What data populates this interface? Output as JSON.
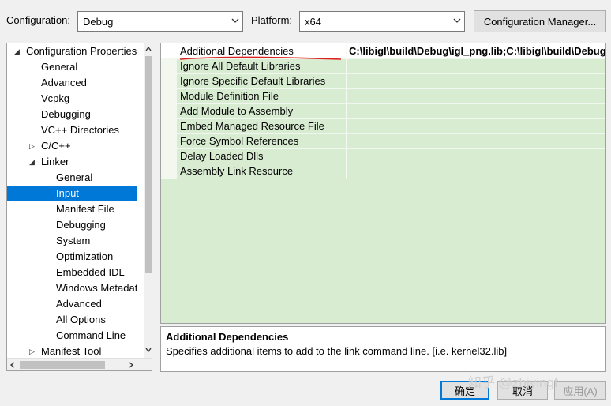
{
  "toolbar": {
    "configuration_label": "Configuration:",
    "configuration_value": "Debug",
    "platform_label": "Platform:",
    "platform_value": "x64",
    "config_manager_button": "Configuration Manager..."
  },
  "tree": {
    "items": [
      {
        "label": "Configuration Properties",
        "glyph": "◢"
      },
      {
        "label": "General"
      },
      {
        "label": "Advanced"
      },
      {
        "label": "Vcpkg"
      },
      {
        "label": "Debugging"
      },
      {
        "label": "VC++ Directories"
      },
      {
        "label": "C/C++",
        "glyph": "▷"
      },
      {
        "label": "Linker",
        "glyph": "◢"
      },
      {
        "label": "General"
      },
      {
        "label": "Input"
      },
      {
        "label": "Manifest File"
      },
      {
        "label": "Debugging"
      },
      {
        "label": "System"
      },
      {
        "label": "Optimization"
      },
      {
        "label": "Embedded IDL"
      },
      {
        "label": "Windows Metadata"
      },
      {
        "label": "Advanced"
      },
      {
        "label": "All Options"
      },
      {
        "label": "Command Line"
      },
      {
        "label": "Manifest Tool",
        "glyph": "▷"
      }
    ]
  },
  "grid": {
    "rows": [
      {
        "name": "Additional Dependencies",
        "value": "C:\\libigl\\build\\Debug\\igl_png.lib;C:\\libigl\\build\\Debug\\"
      },
      {
        "name": "Ignore All Default Libraries",
        "value": ""
      },
      {
        "name": "Ignore Specific Default Libraries",
        "value": ""
      },
      {
        "name": "Module Definition File",
        "value": ""
      },
      {
        "name": "Add Module to Assembly",
        "value": ""
      },
      {
        "name": "Embed Managed Resource File",
        "value": ""
      },
      {
        "name": "Force Symbol References",
        "value": ""
      },
      {
        "name": "Delay Loaded Dlls",
        "value": ""
      },
      {
        "name": "Assembly Link Resource",
        "value": ""
      }
    ]
  },
  "description": {
    "title": "Additional Dependencies",
    "text": "Specifies additional items to add to the link command line. [i.e. kernel32.lib]"
  },
  "buttons": {
    "ok": "确定",
    "cancel": "取消",
    "apply": "应用(A)"
  },
  "watermark": "知乎 @zhiyingf",
  "colors": {
    "selection": "#0078d7",
    "grid_background": "#d8ecd2",
    "annotation_underline": "#e02020"
  }
}
